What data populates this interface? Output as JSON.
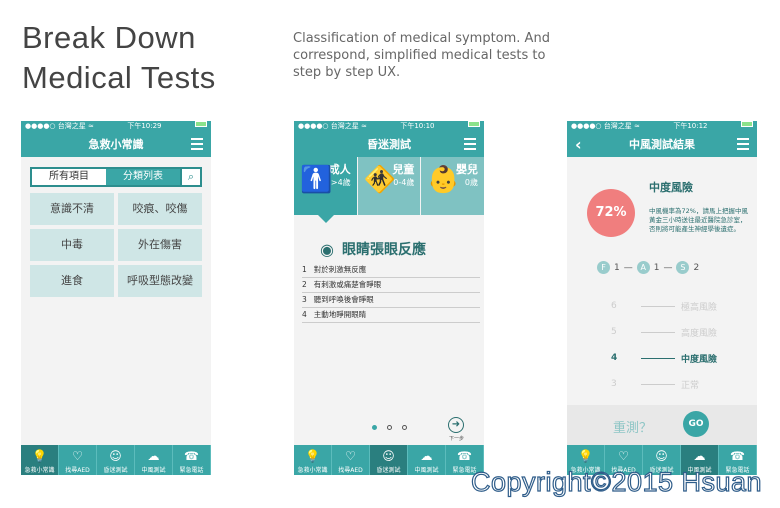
{
  "title_line1": "Break Down",
  "title_line2": "Medical Tests",
  "description": "Classification of medical symptom. And correspond, simplified medical tests to step by step UX.",
  "status": {
    "carrier": "●●●●○ 台灣之星 ≈",
    "battery": "■"
  },
  "phone1": {
    "time": "下午10:29",
    "nav_title": "急救小常識",
    "seg_all": "所有項目",
    "seg_category": "分類列表",
    "search_glyph": "⌕",
    "cells": [
      "意識不清",
      "咬痕、咬傷",
      "中毒",
      "外在傷害",
      "進食",
      "呼吸型態改變"
    ]
  },
  "phone2": {
    "time": "下午10:10",
    "nav_title": "昏迷測試",
    "categories": [
      {
        "name": "成人",
        "age": ">4歲"
      },
      {
        "name": "兒童",
        "age": "0-4歲"
      },
      {
        "name": "嬰兒",
        "age": "0歲"
      }
    ],
    "question": "眼睛張眼反應",
    "options": [
      {
        "n": "1",
        "text": "對於刺激無反應"
      },
      {
        "n": "2",
        "text": "有刺激或痛楚會睜眼"
      },
      {
        "n": "3",
        "text": "聽到呼喚後會睜眼"
      },
      {
        "n": "4",
        "text": "主動地睜開眼睛"
      }
    ],
    "next_label": "下一步"
  },
  "phone3": {
    "time": "下午10:12",
    "nav_title": "中風測試結果",
    "percent": "72%",
    "risk_level": "中度風險",
    "risk_desc": "中風機率為72%，請馬上把握中風黃金三小時送往最近醫院急診室，否則將可能產生神經學後遺症。",
    "fas": [
      {
        "letter": "F",
        "value": "1"
      },
      {
        "letter": "A",
        "value": "1"
      },
      {
        "letter": "S",
        "value": "2"
      }
    ],
    "scale": [
      {
        "num": "6",
        "label": "極高風險"
      },
      {
        "num": "5",
        "label": "高度風險"
      },
      {
        "num": "4",
        "label": "中度風險"
      },
      {
        "num": "3",
        "label": "正常"
      }
    ],
    "retest_q": "重測？",
    "go_label": "GO"
  },
  "tabs": [
    "急救小常識",
    "找尋AED",
    "昏迷測試",
    "中風測試",
    "緊急電話"
  ],
  "copyright": "Copyright©2015 Hsuan"
}
